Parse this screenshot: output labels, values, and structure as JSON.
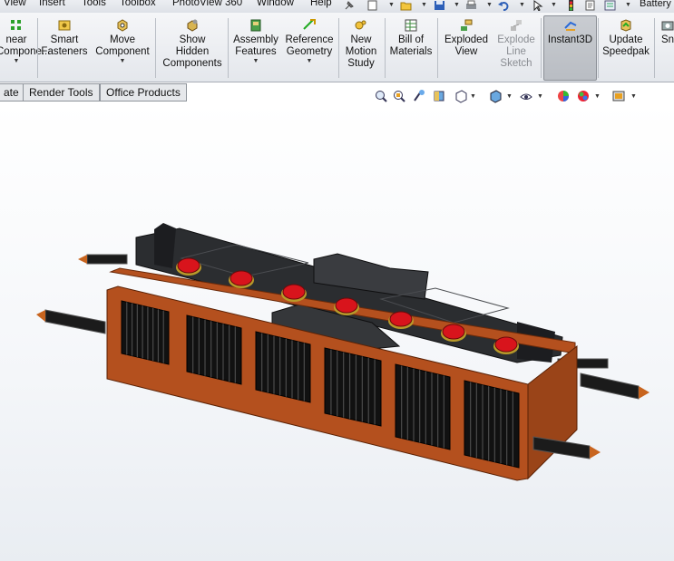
{
  "menubar": {
    "items": [
      {
        "label": "View"
      },
      {
        "label": "Insert"
      },
      {
        "label": "Tools"
      },
      {
        "label": "Toolbox"
      },
      {
        "label": "PhotoView 360"
      },
      {
        "label": "Window"
      },
      {
        "label": "Help"
      }
    ],
    "document_title": "Battery"
  },
  "ribbon": {
    "commands": [
      {
        "label": "near\nCompone...",
        "icon": "linear-pattern-icon"
      },
      {
        "label": "Smart\nFasteners",
        "icon": "smart-fasteners-icon"
      },
      {
        "label": "Move\nComponent",
        "icon": "move-component-icon"
      },
      {
        "label": "Show\nHidden\nComponents",
        "icon": "show-hidden-icon"
      },
      {
        "label": "Assembly\nFeatures",
        "icon": "assembly-features-icon"
      },
      {
        "label": "Reference\nGeometry",
        "icon": "reference-geometry-icon"
      },
      {
        "label": "New\nMotion\nStudy",
        "icon": "motion-study-icon"
      },
      {
        "label": "Bill of\nMaterials",
        "icon": "bill-of-materials-icon"
      },
      {
        "label": "Exploded\nView",
        "icon": "exploded-view-icon"
      },
      {
        "label": "Explode\nLine\nSketch",
        "icon": "explode-line-sketch-icon",
        "disabled": true
      },
      {
        "label": "Instant3D",
        "icon": "instant3d-icon",
        "active": true
      },
      {
        "label": "Update\nSpeedpak",
        "icon": "speedpak-icon"
      },
      {
        "label": "Sn",
        "icon": "snapshot-icon"
      }
    ]
  },
  "tabs": [
    {
      "label": "ate"
    },
    {
      "label": "Render Tools"
    },
    {
      "label": "Office Products"
    }
  ],
  "hud": {
    "buttons": [
      "zoom-to-fit-icon",
      "zoom-to-area-icon",
      "previous-view-icon",
      "section-view-icon",
      "view-orientation-icon",
      "display-style-icon",
      "hide-show-items-icon",
      "edit-appearance-icon",
      "apply-scene-icon",
      "view-settings-icon"
    ]
  },
  "colors": {
    "frame": "#b4501e",
    "battery_top": "#2b2d30",
    "terminal": "#d8141c",
    "rod": "#1b1b1b",
    "rod_tip": "#c8641e"
  }
}
